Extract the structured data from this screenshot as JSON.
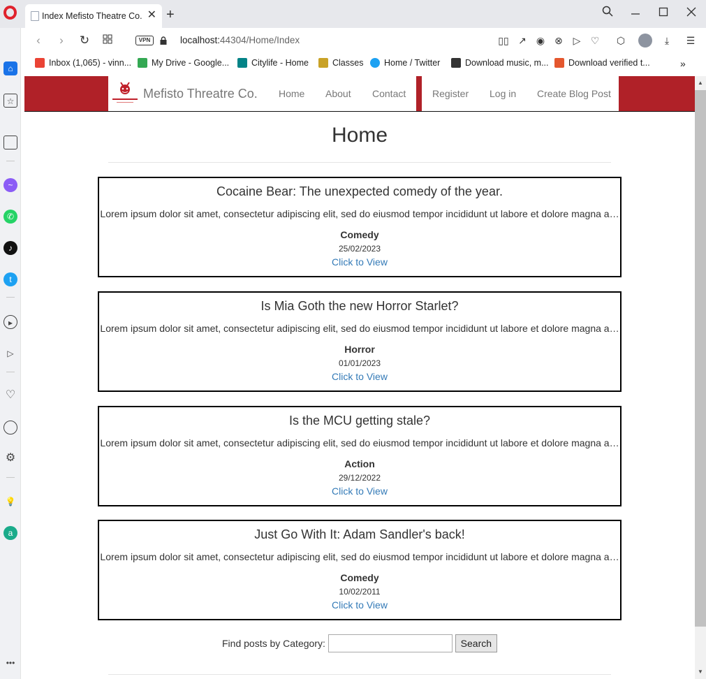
{
  "browser": {
    "tab_title": "Index Mefisto Theatre Co.",
    "url_host": "localhost:",
    "url_rest": "44304/Home/Index",
    "vpn_label": "VPN",
    "bookmarks": [
      {
        "label": "Inbox (1,065) - vinn...",
        "icon": "gmail-icon",
        "color": "#ea4335"
      },
      {
        "label": "My Drive - Google...",
        "icon": "google-drive-icon",
        "color": "#34a853"
      },
      {
        "label": "Citylife - Home",
        "icon": "sharepoint-icon",
        "color": "#038387"
      },
      {
        "label": "Classes",
        "icon": "classes-icon",
        "color": "#c9a227"
      },
      {
        "label": "Home / Twitter",
        "icon": "twitter-icon",
        "color": "#1da1f2"
      },
      {
        "label": "Download music, m...",
        "icon": "music-download-icon",
        "color": "#333333"
      },
      {
        "label": "Download verified t...",
        "icon": "x-site-icon",
        "color": "#e4572e"
      }
    ]
  },
  "site": {
    "brand": "Mefisto Threatre Co.",
    "nav_left": [
      "Home",
      "About",
      "Contact"
    ],
    "nav_right": [
      "Register",
      "Log in",
      "Create Blog Post"
    ],
    "accent_color": "#b02128",
    "link_color": "#337ab7"
  },
  "page": {
    "title": "Home",
    "posts": [
      {
        "title": "Cocaine Bear: The unexpected comedy of the year.",
        "excerpt": "Lorem ipsum dolor sit amet, consectetur adipiscing elit, sed do eiusmod tempor incididunt ut labore et dolore magna a…",
        "category": "Comedy",
        "date": "25/02/2023",
        "link": "Click to View"
      },
      {
        "title": "Is Mia Goth the new Horror Starlet?",
        "excerpt": "Lorem ipsum dolor sit amet, consectetur adipiscing elit, sed do eiusmod tempor incididunt ut labore et dolore magna a…",
        "category": "Horror",
        "date": "01/01/2023",
        "link": "Click to View"
      },
      {
        "title": "Is the MCU getting stale?",
        "excerpt": "Lorem ipsum dolor sit amet, consectetur adipiscing elit, sed do eiusmod tempor incididunt ut labore et dolore magna a…",
        "category": "Action",
        "date": "29/12/2022",
        "link": "Click to View"
      },
      {
        "title": "Just Go With It: Adam Sandler's back!",
        "excerpt": "Lorem ipsum dolor sit amet, consectetur adipiscing elit, sed do eiusmod tempor incididunt ut labore et dolore magna a…",
        "category": "Comedy",
        "date": "10/02/2011",
        "link": "Click to View"
      }
    ],
    "search": {
      "label": "Find posts by Category:",
      "value": "",
      "button": "Search"
    }
  }
}
